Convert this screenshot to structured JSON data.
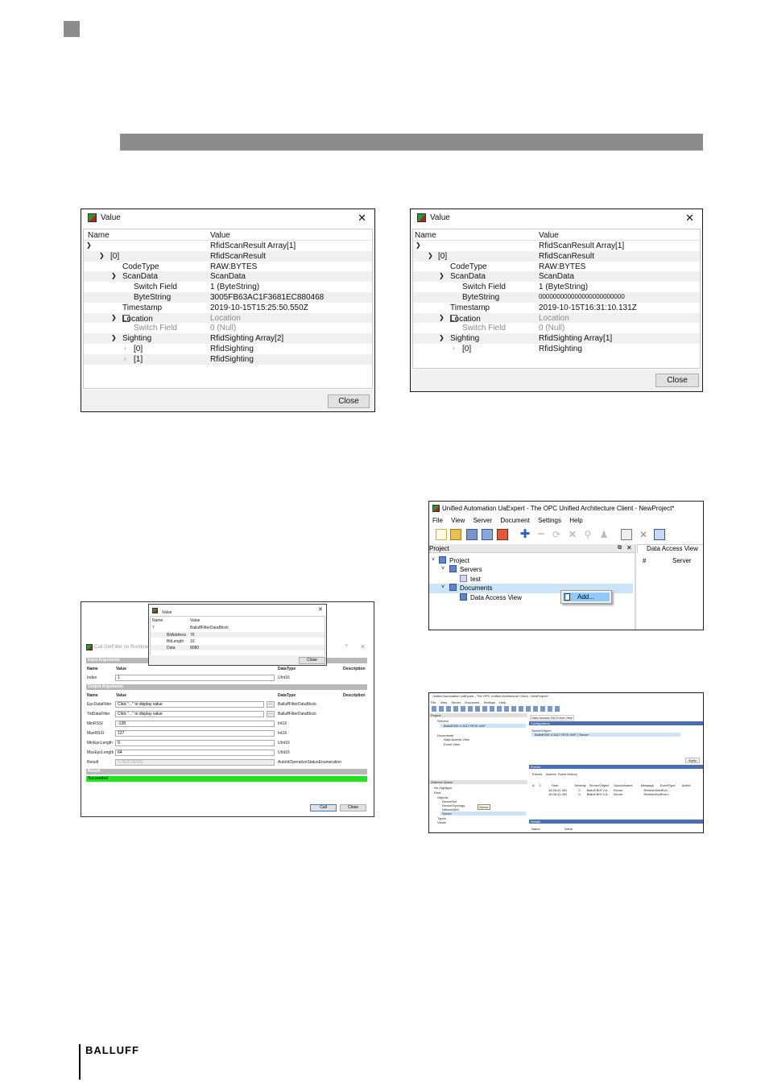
{
  "footer": {
    "brand": "BALLUFF"
  },
  "dialog1": {
    "title": "Value",
    "columns": [
      "Name",
      "Value"
    ],
    "rows": [
      {
        "name": "",
        "value": "RfidScanResult Array[1]"
      },
      {
        "name": "[0]",
        "value": "RfidScanResult"
      },
      {
        "name": "CodeType",
        "value": "RAW:BYTES"
      },
      {
        "name": "ScanData",
        "value": "ScanData"
      },
      {
        "name": "Switch Field",
        "value": "1 (ByteString)"
      },
      {
        "name": "ByteString",
        "value": "3005FB63AC1F3681EC880468"
      },
      {
        "name": "Timestamp",
        "value": "2019-10-15T15:25:50.550Z"
      },
      {
        "name": "Location",
        "value": "Location"
      },
      {
        "name": "Switch Field",
        "value": "0 (Null)"
      },
      {
        "name": "Sighting",
        "value": "RfidSighting Array[2]"
      },
      {
        "name": "[0]",
        "value": "RfidSighting"
      },
      {
        "name": "[1]",
        "value": "RfidSighting"
      }
    ],
    "close_label": "Close"
  },
  "dialog2": {
    "title": "Value",
    "columns": [
      "Name",
      "Value"
    ],
    "rows": [
      {
        "name": "",
        "value": "RfidScanResult Array[1]"
      },
      {
        "name": "[0]",
        "value": "RfidScanResult"
      },
      {
        "name": "CodeType",
        "value": "RAW:BYTES"
      },
      {
        "name": "ScanData",
        "value": "ScanData"
      },
      {
        "name": "Switch Field",
        "value": "1 (ByteString)"
      },
      {
        "name": "ByteString",
        "value": "000000000000000000000000"
      },
      {
        "name": "Timestamp",
        "value": "2019-10-15T16:31:10.131Z"
      },
      {
        "name": "Location",
        "value": "Location"
      },
      {
        "name": "Switch Field",
        "value": "0 (Null)"
      },
      {
        "name": "Sighting",
        "value": "RfidSighting Array[1]"
      },
      {
        "name": "[0]",
        "value": "RfidSighting"
      }
    ],
    "close_label": "Close"
  },
  "call_dialog": {
    "title": "Call GetFilter on RuntimeParam",
    "input_section": "Input Arguments",
    "output_section": "Output Arguments",
    "result_section": "Result",
    "col_name": "Name",
    "col_value": "Value",
    "col_type": "DataType",
    "col_desc": "Description",
    "inputs": [
      {
        "name": "Index",
        "value": "1",
        "type": "UInt16"
      }
    ],
    "outputs": [
      {
        "name": "EpcDataFilter",
        "value": "Click \"...\" to display value",
        "type": "BalluffFilterDataBlock"
      },
      {
        "name": "TidDataFilter",
        "value": "Click \"...\" to display value",
        "type": "BalluffFilterDataBlock"
      },
      {
        "name": "MinRSSI",
        "value": "-128",
        "type": "Int16"
      },
      {
        "name": "MaxRSSI",
        "value": "127",
        "type": "Int16"
      },
      {
        "name": "MinEpcLength",
        "value": "0",
        "type": "UInt16"
      },
      {
        "name": "MaxEpcLength",
        "value": "64",
        "type": "UInt16"
      },
      {
        "name": "Result",
        "value": "0 (SUCCESS)",
        "type": "AutoIdOperationStatusEnumeration"
      }
    ],
    "result_value": "Succeeded",
    "call_label": "Call",
    "close_label": "Close",
    "help_label": "?",
    "popup": {
      "title": "Value",
      "col_name": "Name",
      "col_value": "Value",
      "root_value": "BalluffFilterDataBlock",
      "rows": [
        {
          "name": "BitAddress",
          "value": "76"
        },
        {
          "name": "BitLength",
          "value": "16"
        },
        {
          "name": "Data",
          "value": "8080"
        }
      ],
      "close_label": "Close"
    }
  },
  "uaexpert": {
    "title": "Unified Automation UaExpert - The OPC Unified Architecture Client - NewProject*",
    "menu": [
      "File",
      "View",
      "Server",
      "Document",
      "Settings",
      "Help"
    ],
    "project_panel": "Project",
    "dav_tab": "Data Access View",
    "col_hash": "#",
    "col_server": "Server",
    "tree": [
      "Project",
      "Servers",
      "test",
      "Documents",
      "Data Access View"
    ],
    "context_menu": "Add..."
  },
  "uaexpert2": {
    "title": "Unified Automation UaExpert - The OPC Unified Architecture Client - NewProject*",
    "menu": [
      "File",
      "View",
      "Server",
      "Document",
      "Settings",
      "Help"
    ],
    "project": "Project",
    "servers": "Servers",
    "server_item": "Balluff BIS V-6117 RFID UHF",
    "documents": "Documents",
    "dav": "Data Access View",
    "event_view": "Event View",
    "tabs": [
      "Data Access View",
      "Event View"
    ],
    "configuration": "Configuration",
    "server_object_header": "Server/Object",
    "server_object_row": "Balluff BIS V-6117 RFID UHF | Server",
    "apply": "Apply",
    "events": "Events",
    "event_tabs": [
      "Events",
      "Alarms",
      "Event History"
    ],
    "event_cols": [
      "A",
      "C",
      "Time",
      "Severity",
      "Server/Object",
      "SourceName",
      "Message",
      "EventType",
      "Active"
    ],
    "event_rows": [
      [
        "",
        "",
        "16:26:41.451",
        "0",
        "Balluff BIS V-6...",
        "Server",
        "",
        "RefreshStartEve...",
        ""
      ],
      [
        "",
        "",
        "16:26:41.451",
        "0",
        "Balluff BIS V-6...",
        "Server",
        "",
        "RefreshEndEven...",
        ""
      ]
    ],
    "details": "Details",
    "details_cols": [
      "Name",
      "Value"
    ],
    "address_space": "Address Space",
    "no_highlight": "No Highlight",
    "address_tree": [
      "Root",
      "Objects",
      "DeviceSet",
      "DeviceTopology",
      "NetworkSet",
      "Server",
      "Types",
      "Views"
    ],
    "tooltip": "Server"
  }
}
